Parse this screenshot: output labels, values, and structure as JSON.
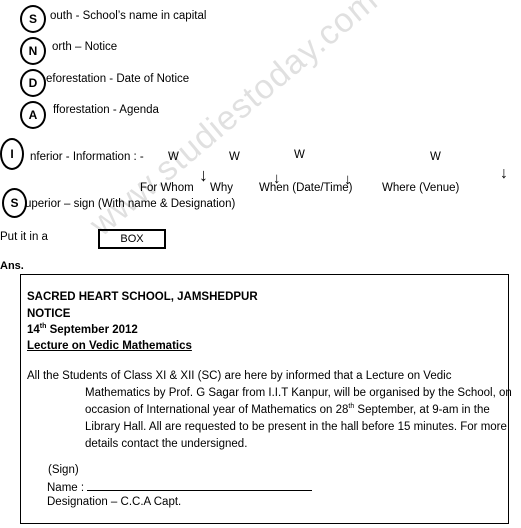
{
  "snda_mnemonic": [
    {
      "letter": "S",
      "text": "outh - School’s name in capital"
    },
    {
      "letter": "N",
      "text": "orth – Notice"
    },
    {
      "letter": "D",
      "text": "eforestation - Date of Notice"
    },
    {
      "letter": "A",
      "text": "fforestation -  Agenda"
    }
  ],
  "is_mnemonic": [
    {
      "letter": "I",
      "text": "nferior - Information : -"
    },
    {
      "letter": "S",
      "text": "uperior – sign (With name & Designation)"
    }
  ],
  "w_labels": [
    "W",
    "W",
    "W",
    "W"
  ],
  "w_meanings": [
    "For Whom",
    "Why",
    "When (Date/Time)",
    "Where (Venue)"
  ],
  "arrow_icon": "↓",
  "put_in_box": {
    "label": "Put it in a",
    "box_text": "BOX"
  },
  "ans_label": "Ans.",
  "watermark": "www.studiestoday.com",
  "notice": {
    "school": "SACRED HEART SCHOOL, JAMSHEDPUR",
    "heading": "NOTICE",
    "date_day": "14",
    "date_suffix": "th",
    "date_rest": " September 2012",
    "subject": "Lecture on Vedic Mathematics",
    "body_line1": "All the Students of Class XI & XII (SC) are here by informed that a  Lecture on Vedic",
    "body_line2": "Mathematics by Prof. G Sagar  from I.I.T Kanpur, will be organised by the School, on",
    "body_line3a": "occasion of International year of Mathematics on 28",
    "body_line3_sup": "th",
    "body_line3b": " September, at 9-am in the",
    "body_line4": "Library Hall.  All are requested to be present in the hall before 15 minutes. For more",
    "body_line5": "details contact the undersigned.",
    "sign": "(Sign)",
    "name_label": "Name :",
    "designation": "Designation – C.C.A Capt."
  }
}
